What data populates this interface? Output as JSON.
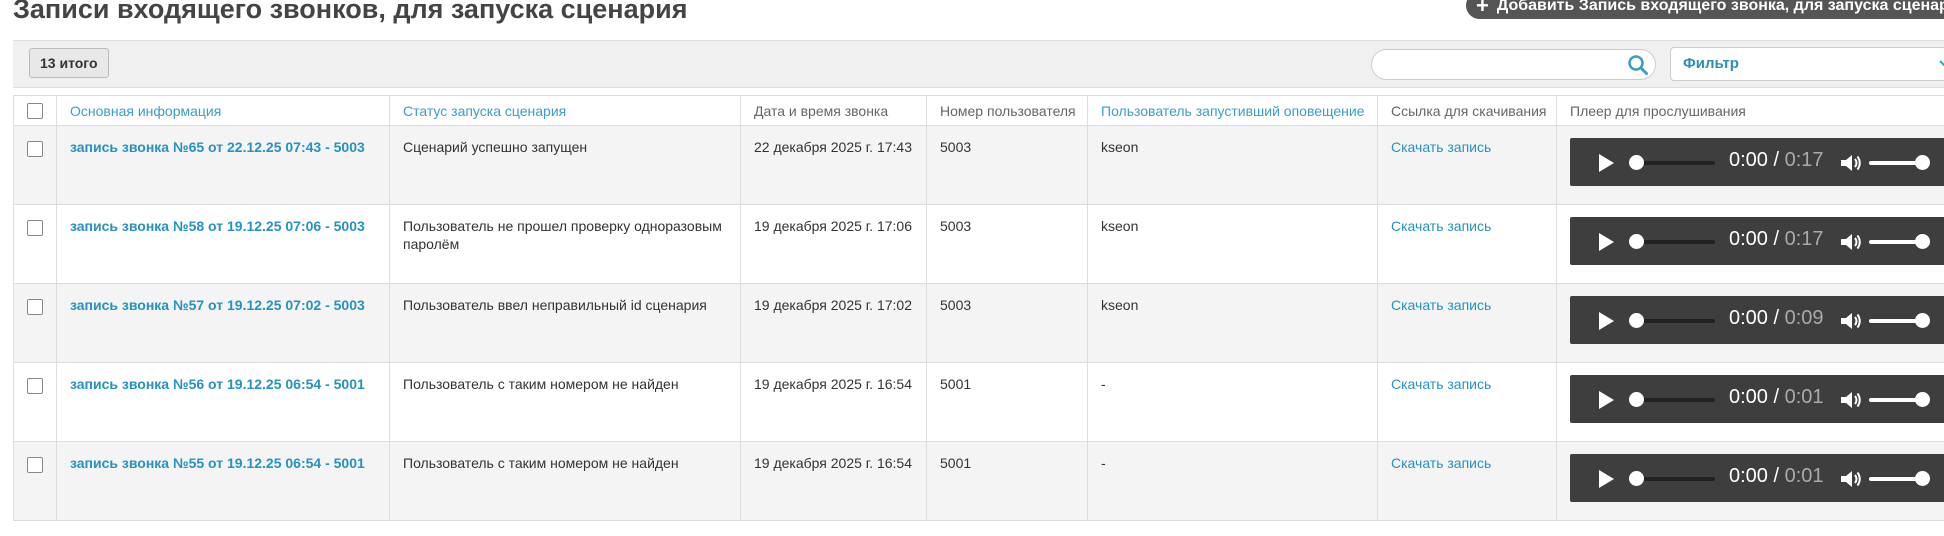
{
  "header": {
    "title": "Записи входящего звонков, для запуска сценария",
    "add_button_label": "Добавить Запись входящего звонка, для запуска сценария"
  },
  "toolbar": {
    "total_label": "13 итого",
    "search_placeholder": "",
    "search_value": "",
    "filter_label": "Фильтр"
  },
  "table": {
    "columns": [
      "Основная информация",
      "Статус запуска сценария",
      "Дата и время звонка",
      "Номер пользователя",
      "Пользователь запустивший оповещение",
      "Ссылка для скачивания",
      "Плеер для прослушивания"
    ],
    "rows": [
      {
        "title": "запись звонка №65 от 22.12.25 07:43 - 5003",
        "status": "Сценарий успешно запущен",
        "datetime": "22 декабря 2025 г. 17:43",
        "number": "5003",
        "user": "kseon",
        "download": "Скачать запись",
        "time": "0:00",
        "duration": "0:17",
        "progress": 0
      },
      {
        "title": "запись звонка №58 от 19.12.25 07:06 - 5003",
        "status": "Пользователь не прошел проверку одноразовым паролём",
        "datetime": "19 декабря 2025 г. 17:06",
        "number": "5003",
        "user": "kseon",
        "download": "Скачать запись",
        "time": "0:00",
        "duration": "0:17",
        "progress": 0
      },
      {
        "title": "запись звонка №57 от 19.12.25 07:02 - 5003",
        "status": "Пользователь ввел неправильный id сценария",
        "datetime": "19 декабря 2025 г. 17:02",
        "number": "5003",
        "user": "kseon",
        "download": "Скачать запись",
        "time": "0:00",
        "duration": "0:09",
        "progress": 0
      },
      {
        "title": "запись звонка №56 от 19.12.25 06:54 - 5001",
        "status": "Пользователь с таким номером не найден",
        "datetime": "19 декабря 2025 г. 16:54",
        "number": "5001",
        "user": "-",
        "download": "Скачать запись",
        "time": "0:00",
        "duration": "0:01",
        "progress": 0
      },
      {
        "title": "запись звонка №55 от 19.12.25 06:54 - 5001",
        "status": "Пользователь с таким номером не найден",
        "datetime": "19 декабря 2025 г. 16:54",
        "number": "5001",
        "user": "-",
        "download": "Скачать запись",
        "time": "0:00",
        "duration": "0:01",
        "progress": 0
      }
    ]
  },
  "colors": {
    "accent_link": "#2592bf",
    "header_button_bg": "#555555",
    "player_bg": "#3e3e3e"
  },
  "icons": {
    "add": "plus-icon",
    "search": "search-icon",
    "filter": "chevron-down-icon",
    "play": "play-icon",
    "volume": "volume-icon"
  }
}
